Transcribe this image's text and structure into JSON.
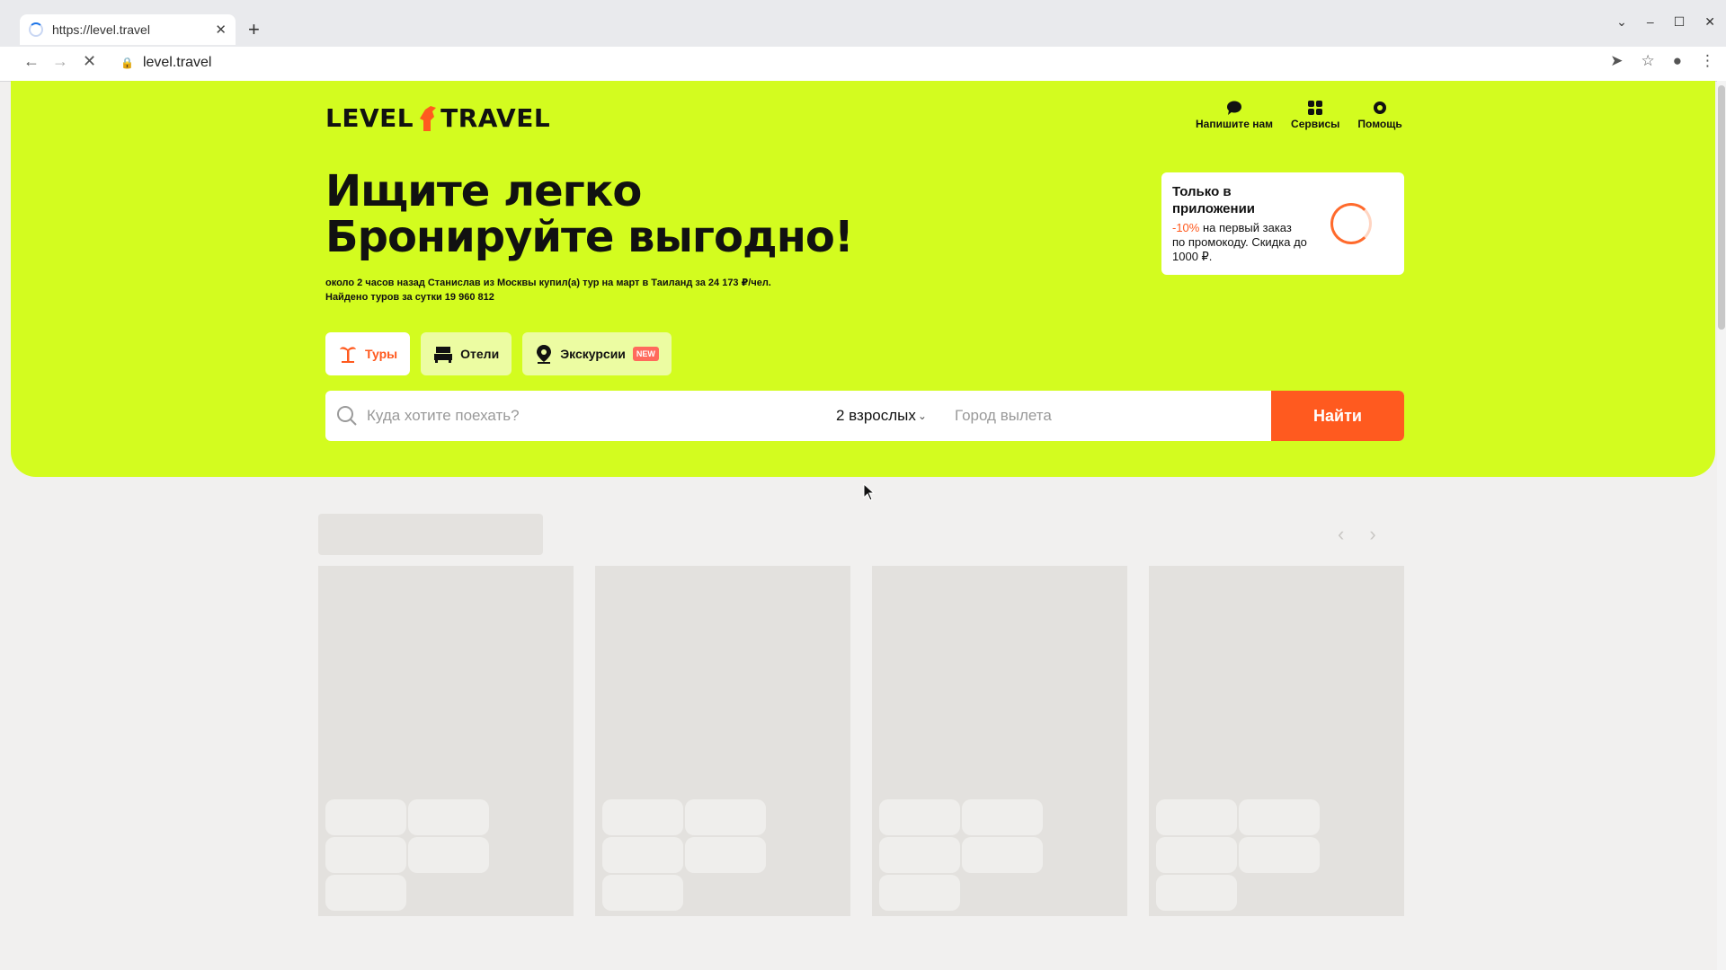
{
  "browser": {
    "tab_title": "https://level.travel",
    "url": "level.travel",
    "new_tab": "+",
    "close": "✕"
  },
  "header": {
    "logo_left": "LEVEL",
    "logo_right": "TRAVEL",
    "links": [
      {
        "label": "Напишите нам",
        "icon": "chat-icon"
      },
      {
        "label": "Сервисы",
        "icon": "grid-icon"
      },
      {
        "label": "Помощь",
        "icon": "lifebuoy-icon"
      }
    ]
  },
  "hero": {
    "headline_line1": "Ищите легко",
    "headline_line2": "Бронируйте выгодно!",
    "activity": "около 2 часов назад Станислав из Москвы купил(а) тур на март в Таиланд за 24 173 ₽/чел.",
    "found": "Найдено туров за сутки 19 960 812"
  },
  "promo": {
    "title": "Только в приложении",
    "discount": "-10%",
    "text": "на первый заказ по промокоду. Скидка до 1000 ₽."
  },
  "categories": [
    {
      "label": "Туры",
      "icon": "palm-icon",
      "active": true
    },
    {
      "label": "Отели",
      "icon": "bed-icon",
      "active": false
    },
    {
      "label": "Экскурсии",
      "icon": "pin-icon",
      "active": false,
      "badge": "NEW"
    }
  ],
  "search": {
    "destination_placeholder": "Куда хотите поехать?",
    "adults": "2 взрослых",
    "city_placeholder": "Город вылета",
    "button": "Найти"
  },
  "colors": {
    "accent": "#d3fc1f",
    "brand": "#ff5a1f"
  }
}
